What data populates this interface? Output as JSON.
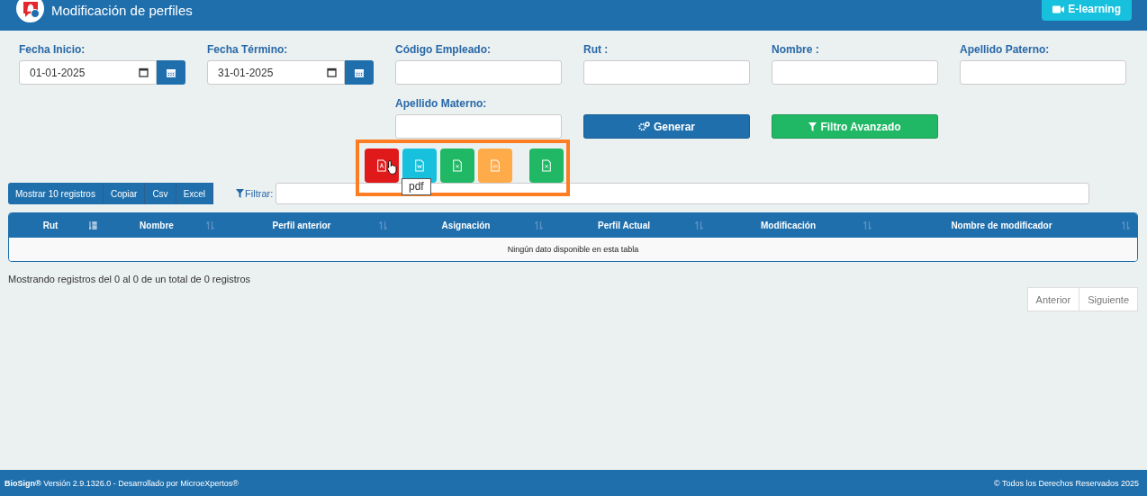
{
  "header": {
    "title": "Modificación de perfiles",
    "elearning_button": "E-learning"
  },
  "filters": [
    {
      "kind": "date",
      "label": "Fecha Inicio:",
      "value": "01-01-2025"
    },
    {
      "kind": "date",
      "label": "Fecha Término:",
      "value": "31-01-2025"
    },
    {
      "kind": "text",
      "label": "Código Empleado:"
    },
    {
      "kind": "text",
      "label": "Rut :"
    },
    {
      "kind": "text",
      "label": "Nombre :"
    },
    {
      "kind": "text",
      "label": "Apellido Paterno:"
    },
    {
      "kind": "text",
      "label": "Apellido Materno:"
    }
  ],
  "actions": [
    {
      "kind": "generate",
      "label": "Generar"
    },
    {
      "kind": "filter",
      "label": "Filtro Avanzado"
    }
  ],
  "export_group": {
    "highlighted": true,
    "groups": [
      [
        {
          "kind": "pdf",
          "hovered": true,
          "tooltip": "pdf"
        },
        {
          "kind": "word",
          "hovered": false
        },
        {
          "kind": "excel",
          "hovered": false
        },
        {
          "kind": "code",
          "hovered": false
        }
      ],
      [
        {
          "kind": "excel",
          "hovered": false
        }
      ]
    ]
  },
  "table_buttons": [
    "Mostrar 10 registros",
    "Copiar",
    "Csv",
    "Excel"
  ],
  "filter_label": "Filtrar:",
  "table": {
    "columns": [
      {
        "label": "Rut",
        "sorted": true
      },
      {
        "label": "Nombre",
        "sorted": false
      },
      {
        "label": "Perfil anterior",
        "sorted": false
      },
      {
        "label": "Asignación",
        "sorted": false
      },
      {
        "label": "Perfil Actual",
        "sorted": false
      },
      {
        "label": "Modificación",
        "sorted": false
      },
      {
        "label": "Nombre de modificador",
        "sorted": false
      }
    ],
    "empty_message": "Ningún dato disponible en esta tabla"
  },
  "info": "Mostrando registros del 0 al 0 de un total de 0 registros",
  "pagination": [
    "Anterior",
    "Siguiente"
  ],
  "footer": {
    "left": "**BioSign®** Versión 2.9.1326.0 - Desarrollado por MicroeXpertos®",
    "right": "© Todos los Derechos Reservados 2025"
  }
}
